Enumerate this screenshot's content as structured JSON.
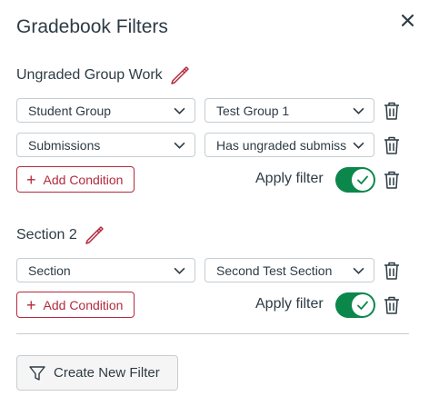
{
  "panel": {
    "title": "Gradebook Filters",
    "close_icon": "close-icon"
  },
  "filters": [
    {
      "name": "Ungraded Group Work",
      "conditions": [
        {
          "type": "Student Group",
          "value": "Test Group 1"
        },
        {
          "type": "Submissions",
          "value": "Has ungraded submiss"
        }
      ],
      "add_condition_label": "Add Condition",
      "apply_label": "Apply filter",
      "applied": true
    },
    {
      "name": "Section 2",
      "conditions": [
        {
          "type": "Section",
          "value": "Second Test Section"
        }
      ],
      "add_condition_label": "Add Condition",
      "apply_label": "Apply filter",
      "applied": true
    }
  ],
  "footer": {
    "create_label": "Create New Filter"
  },
  "colors": {
    "accent": "#b52a3c",
    "toggle_on": "#0b874b",
    "text": "#2d3b45",
    "border": "#c7cdd1"
  }
}
